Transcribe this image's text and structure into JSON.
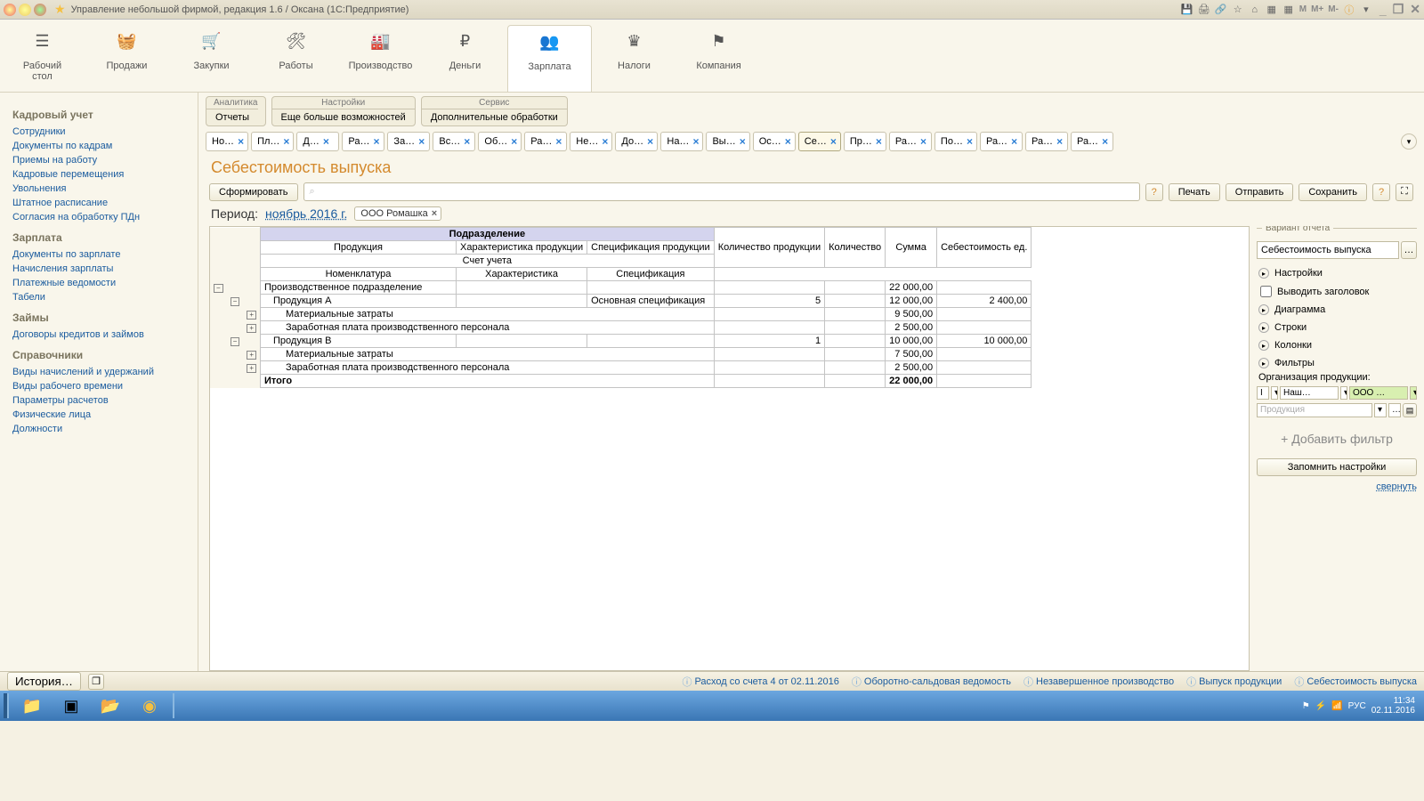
{
  "window": {
    "title": "Управление небольшой фирмой, редакция 1.6 / Оксана  (1С:Предприятие)"
  },
  "toolbar_m": [
    "M",
    "M+",
    "M-"
  ],
  "topnav": [
    {
      "icon": "☰",
      "label": "Рабочий\nстол"
    },
    {
      "icon": "🧺",
      "label": "Продажи"
    },
    {
      "icon": "🛒",
      "label": "Закупки"
    },
    {
      "icon": "🛠",
      "label": "Работы"
    },
    {
      "icon": "🏭",
      "label": "Производство"
    },
    {
      "icon": "₽",
      "label": "Деньги"
    },
    {
      "icon": "👥",
      "label": "Зарплата"
    },
    {
      "icon": "♛",
      "label": "Налоги"
    },
    {
      "icon": "⚑",
      "label": "Компания"
    }
  ],
  "topnav_active": 6,
  "sidebar": [
    {
      "head": "Кадровый учет",
      "items": [
        "Сотрудники",
        "Документы по кадрам",
        "Приемы на работу",
        "Кадровые перемещения",
        "Увольнения",
        "Штатное расписание",
        "Согласия на обработку ПДн"
      ]
    },
    {
      "head": "Зарплата",
      "items": [
        "Документы по зарплате",
        "Начисления зарплаты",
        "Платежные ведомости",
        "Табели"
      ]
    },
    {
      "head": "Займы",
      "items": [
        "Договоры кредитов и займов"
      ]
    },
    {
      "head": "Справочники",
      "items": [
        "Виды начислений и удержаний",
        "Виды рабочего времени",
        "Параметры расчетов",
        "Физические лица",
        "Должности"
      ]
    }
  ],
  "subtabs": [
    {
      "head": "Аналитика",
      "items": [
        "Отчеты"
      ]
    },
    {
      "head": "Настройки",
      "items": [
        "Еще больше возможностей"
      ]
    },
    {
      "head": "Сервис",
      "items": [
        "Дополнительные обработки"
      ]
    }
  ],
  "doctabs": [
    "Но…",
    "Пл…",
    "Д…",
    "Ра…",
    "За…",
    "Вс…",
    "Об…",
    "Ра…",
    "Не…",
    "До…",
    "На…",
    "Вы…",
    "Ос…",
    "Се…",
    "Пр…",
    "Ра…",
    "По…",
    "Ра…",
    "Ра…",
    "Ра…"
  ],
  "doctabs_active": 13,
  "page": {
    "title": "Себестоимость выпуска",
    "btn_form": "Сформировать",
    "search_placeholder": "⌕",
    "btn_print": "Печать",
    "btn_send": "Отправить",
    "btn_save": "Сохранить",
    "period_label": "Период:",
    "period_value": "ноябрь 2016 г.",
    "chip": "ООО Ромашка"
  },
  "report": {
    "band": "Подразделение",
    "headers_r1": [
      "Продукция",
      "Характеристика продукции",
      "Спецификация продукции",
      "Количество продукции",
      "Количество",
      "Сумма",
      "Себестоимость ед."
    ],
    "headers_r2": [
      "Счет учета"
    ],
    "headers_r3": [
      "Номенклатура",
      "Характеристика",
      "Спецификация"
    ],
    "rows": [
      {
        "lvl": 0,
        "cells": [
          "Производственное подразделение",
          "",
          "",
          "",
          "",
          "22 000,00",
          ""
        ],
        "exp": "-"
      },
      {
        "lvl": 1,
        "cells": [
          "Продукция А",
          "",
          "Основная спецификация",
          "5",
          "",
          "12 000,00",
          "2 400,00"
        ],
        "exp": "-"
      },
      {
        "lvl": 2,
        "cells": [
          "Материальные затраты",
          "",
          "",
          "",
          "",
          "9 500,00",
          ""
        ],
        "exp": "+"
      },
      {
        "lvl": 2,
        "cells": [
          "Заработная плата производственного персонала",
          "",
          "",
          "",
          "",
          "2 500,00",
          ""
        ],
        "exp": "+"
      },
      {
        "lvl": 1,
        "cells": [
          "Продукция В",
          "",
          "",
          "1",
          "",
          "10 000,00",
          "10 000,00"
        ],
        "exp": "-"
      },
      {
        "lvl": 2,
        "cells": [
          "Материальные затраты",
          "",
          "",
          "",
          "",
          "7 500,00",
          ""
        ],
        "exp": "+"
      },
      {
        "lvl": 2,
        "cells": [
          "Заработная плата производственного персонала",
          "",
          "",
          "",
          "",
          "2 500,00",
          ""
        ],
        "exp": "+"
      }
    ],
    "total": {
      "label": "Итого",
      "sum": "22 000,00"
    }
  },
  "rpanel": {
    "variant_head": "Вариант отчета",
    "variant_value": "Себестоимость выпуска",
    "sections": [
      "Настройки",
      "Диаграмма",
      "Строки",
      "Колонки",
      "Фильтры"
    ],
    "chk_header": "Выводить заголовок",
    "filter_org_label": "Организация продукции:",
    "filter_org": [
      "I",
      "Наш…",
      "ООО …"
    ],
    "filter_prod": "Продукция",
    "add_filter": "+ Добавить фильтр",
    "btn_remember": "Запомнить настройки",
    "collapse": "свернуть"
  },
  "statusbar": {
    "history": "История…",
    "links": [
      "Расход со счета 4 от 02.11.2016",
      "Оборотно-сальдовая ведомость",
      "Незавершенное производство",
      "Выпуск продукции",
      "Себестоимость выпуска"
    ]
  },
  "taskbar": {
    "lang": "РУС",
    "time": "11:34",
    "date": "02.11.2016"
  }
}
